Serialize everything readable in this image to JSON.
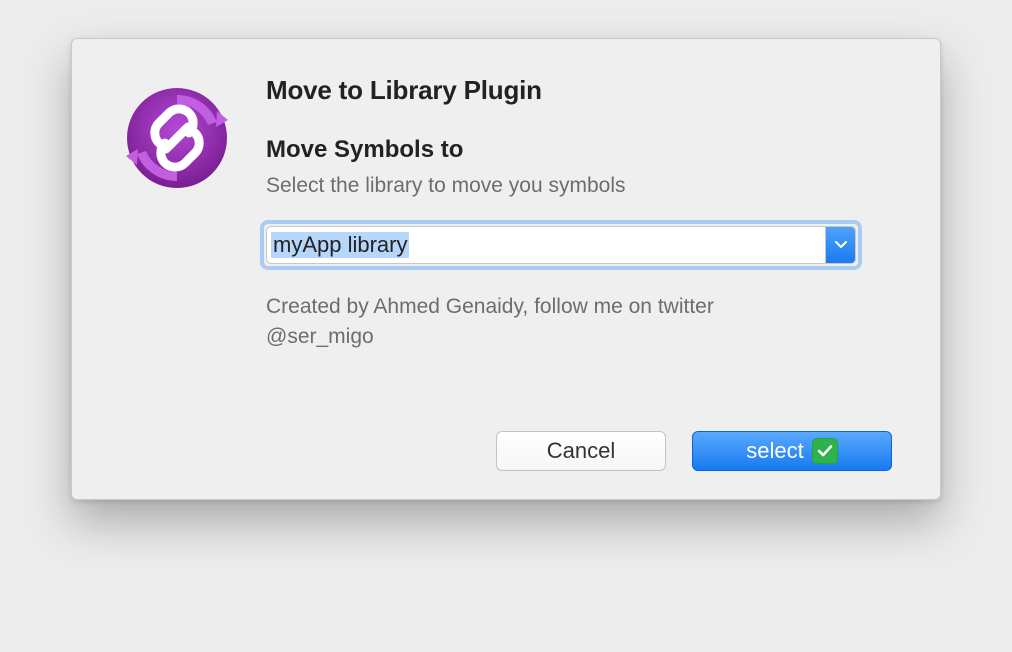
{
  "dialog": {
    "title": "Move to Library Plugin",
    "subtitle": "Move Symbols to",
    "description": "Select the library to move you symbols",
    "selectedLibrary": "myApp library",
    "credits": "Created by Ahmed Genaidy, follow me on twitter @ser_migo",
    "buttons": {
      "cancel": "Cancel",
      "select": "select"
    }
  },
  "icons": {
    "plugin": "link-arrows-icon",
    "chevron": "chevron-down-icon",
    "check": "check-icon"
  },
  "colors": {
    "accentPurple": "#8e2aa6",
    "accentBlue": "#1a7af0",
    "badgeGreen": "#2fb24c"
  }
}
